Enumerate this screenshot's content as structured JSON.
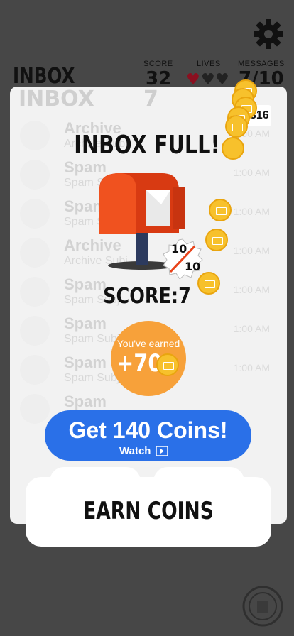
{
  "hud": {
    "inbox_title": "INBOX",
    "score_label": "SCORE",
    "score_value": "32",
    "lives_label": "LIVES",
    "messages_label": "MESSAGES",
    "messages_value": "7/10",
    "coins_value": "316"
  },
  "background_card": {
    "title": "INBOX",
    "score_value": "7",
    "rows": [
      {
        "title": "Archive",
        "subtitle": "Archive Subj",
        "time": "1:00 AM"
      },
      {
        "title": "Spam",
        "subtitle": "Spam Subj",
        "time": "1:00 AM"
      },
      {
        "title": "Spam",
        "subtitle": "Spam Subj",
        "time": "1:00 AM"
      },
      {
        "title": "Archive",
        "subtitle": "Archive Subj",
        "time": "1:00 AM"
      },
      {
        "title": "Spam",
        "subtitle": "Spam Subj",
        "time": "1:00 AM"
      },
      {
        "title": "Spam",
        "subtitle": "Spam Subj",
        "time": "1:00 AM"
      },
      {
        "title": "Spam",
        "subtitle": "Spam Subj",
        "time": "1:00 AM"
      },
      {
        "title": "Spam",
        "subtitle": "",
        "time": ""
      }
    ]
  },
  "popup": {
    "title": "INBOX FULL!",
    "badge_top": "10",
    "badge_bottom": "10",
    "score_text": "SCORE:7",
    "earned_label": "You've earned",
    "earned_value": "+70",
    "get_coins_label": "Get 140 Coins!",
    "watch_label": "Watch"
  },
  "earn_button_label": "EARN COINS",
  "colors": {
    "accent_blue": "#2a70e8",
    "earn_orange": "#f7a13a",
    "coin_gold": "#f7c12c",
    "mailbox_red": "#e8431a"
  }
}
